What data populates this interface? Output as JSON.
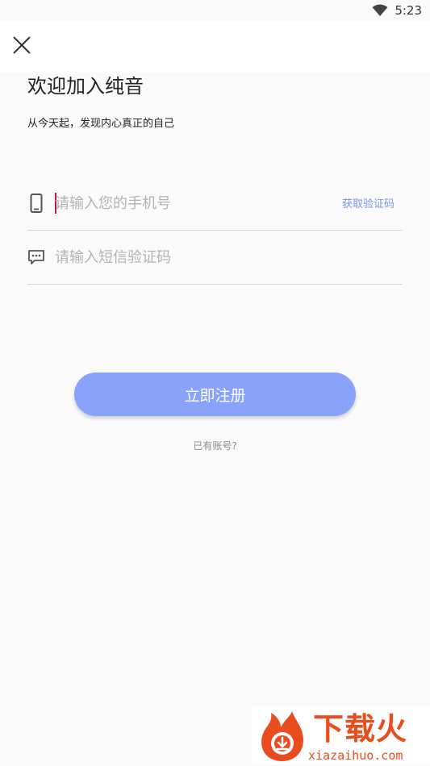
{
  "status_bar": {
    "time": "5:23",
    "wifi_icon": "wifi-icon"
  },
  "toolbar": {
    "close_icon": "close-icon"
  },
  "welcome": {
    "title": "欢迎加入纯音",
    "subtitle": "从今天起，发现内心真正的自己"
  },
  "form": {
    "phone": {
      "icon": "phone-icon",
      "placeholder": "请输入您的手机号",
      "value": "",
      "get_code_label": "获取验证码"
    },
    "sms": {
      "icon": "message-icon",
      "placeholder": "请输入短信验证码",
      "value": ""
    }
  },
  "actions": {
    "register_label": "立即注册",
    "have_account_label": "已有账号?"
  },
  "watermark": {
    "brand": "下载火",
    "url": "xiazaihuo.com"
  },
  "colors": {
    "accent": "#89a3fb",
    "link": "#7a95e6",
    "caret": "#c2185b",
    "watermark": "#e84c1f"
  }
}
